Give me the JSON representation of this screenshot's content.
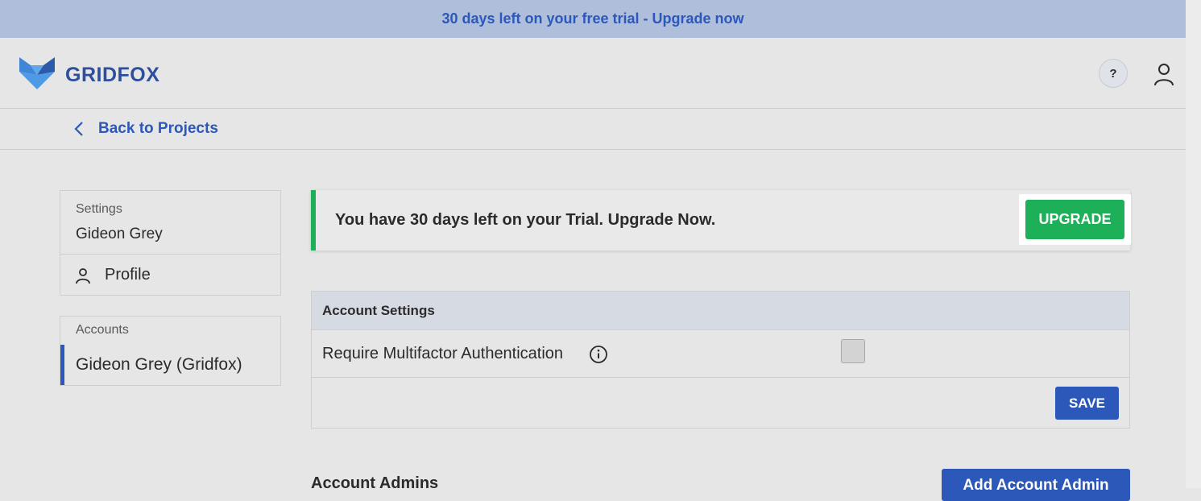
{
  "trial_banner": {
    "text": "30 days left on your free trial - Upgrade now"
  },
  "header": {
    "brand": "GRIDFOX",
    "help_label": "?",
    "icons": {
      "logo": "fox-logo",
      "help": "question-icon",
      "user": "user-icon"
    }
  },
  "nav": {
    "back_label": "Back to Projects",
    "back_icon": "chevron-left-icon"
  },
  "sidebar": {
    "settings_caption": "Settings",
    "user_name": "Gideon Grey",
    "profile_label": "Profile",
    "accounts_caption": "Accounts",
    "account_label": "Gideon Grey (Gridfox)"
  },
  "upgrade_notice": {
    "text": "You have 30 days left on your Trial. Upgrade Now.",
    "button_label": "UPGRADE"
  },
  "account_settings": {
    "title": "Account Settings",
    "mfa_label": "Require Multifactor Authentication",
    "mfa_checked": false,
    "save_label": "SAVE"
  },
  "admins": {
    "heading": "Account Admins",
    "add_label": "Add Account Admin"
  },
  "colors": {
    "accent": "#2c58b9",
    "brand": "#2d4f9e",
    "success": "#1eb058",
    "banner_bg": "#aebedb",
    "page_bg": "#e6e6e6"
  }
}
